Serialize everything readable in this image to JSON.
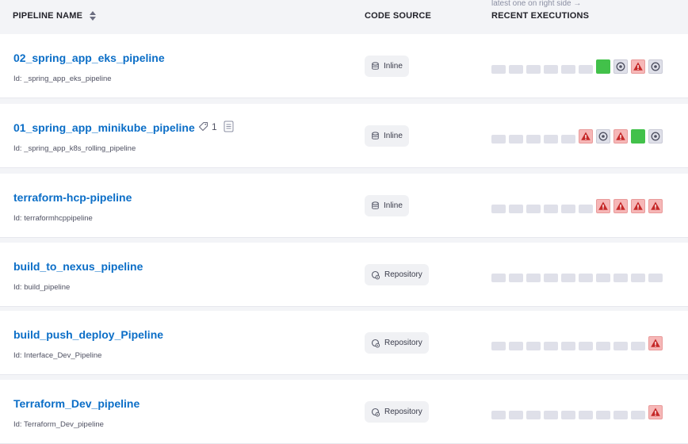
{
  "header": {
    "pipeline_name": "PIPELINE NAME",
    "code_source": "CODE SOURCE",
    "recent_executions": "RECENT EXECUTIONS",
    "executions_hint": "latest one on right side →"
  },
  "colors": {
    "link": "#0b6ec7",
    "success": "#42c14a",
    "failed": "#f6b7b7",
    "empty": "#dfe0e9"
  },
  "pipelines": [
    {
      "name": "02_spring_app_eks_pipeline",
      "id_text": "Id: _spring_app_eks_pipeline",
      "source": "Inline",
      "source_icon": "inline-icon",
      "executions": [
        "none",
        "none",
        "none",
        "none",
        "none",
        "none",
        "success",
        "aborted",
        "failed",
        "aborted"
      ]
    },
    {
      "name": "01_spring_app_minikube_pipeline",
      "id_text": "Id: _spring_app_k8s_rolling_pipeline",
      "tag_count": "1",
      "source": "Inline",
      "source_icon": "inline-icon",
      "executions": [
        "none",
        "none",
        "none",
        "none",
        "none",
        "failed",
        "aborted",
        "failed",
        "success",
        "aborted"
      ]
    },
    {
      "name": "terraform-hcp-pipeline",
      "id_text": "Id: terraformhcppipeline",
      "source": "Inline",
      "source_icon": "inline-icon",
      "executions": [
        "none",
        "none",
        "none",
        "none",
        "none",
        "none",
        "failed",
        "failed",
        "failed",
        "failed"
      ]
    },
    {
      "name": "build_to_nexus_pipeline",
      "id_text": "Id: build_pipeline",
      "source": "Repository",
      "source_icon": "repository-icon",
      "executions": [
        "none",
        "none",
        "none",
        "none",
        "none",
        "none",
        "none",
        "none",
        "none",
        "none"
      ]
    },
    {
      "name": "build_push_deploy_Pipeline",
      "id_text": "Id: Interface_Dev_Pipeline",
      "source": "Repository",
      "source_icon": "repository-icon",
      "executions": [
        "none",
        "none",
        "none",
        "none",
        "none",
        "none",
        "none",
        "none",
        "none",
        "failed"
      ]
    },
    {
      "name": "Terraform_Dev_pipeline",
      "id_text": "Id: Terraform_Dev_pipeline",
      "source": "Repository",
      "source_icon": "repository-icon",
      "executions": [
        "none",
        "none",
        "none",
        "none",
        "none",
        "none",
        "none",
        "none",
        "none",
        "failed"
      ]
    }
  ]
}
